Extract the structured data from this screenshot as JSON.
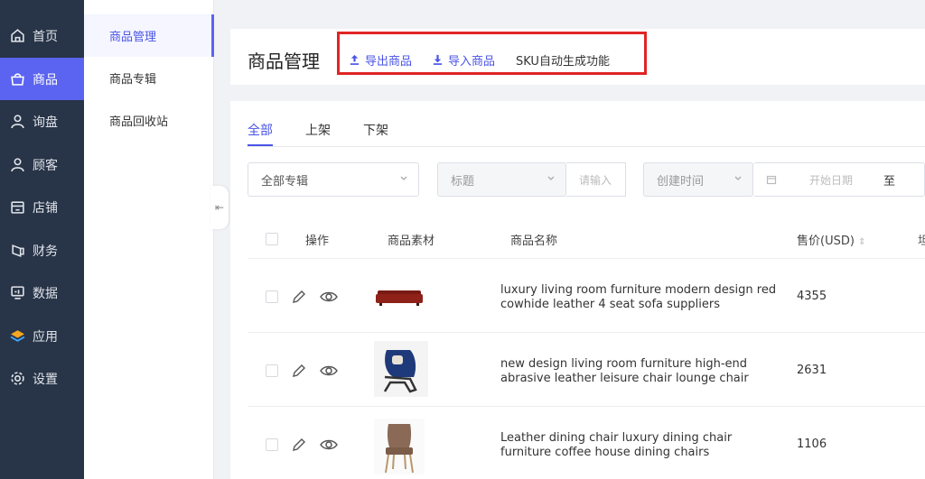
{
  "sidebar": {
    "items": [
      {
        "label": "首页",
        "icon": "home-icon"
      },
      {
        "label": "商品",
        "icon": "bag-icon"
      },
      {
        "label": "询盘",
        "icon": "person-icon"
      },
      {
        "label": "顾客",
        "icon": "person-icon"
      },
      {
        "label": "店铺",
        "icon": "store-icon"
      },
      {
        "label": "财务",
        "icon": "wallet-icon"
      },
      {
        "label": "数据",
        "icon": "monitor-icon"
      },
      {
        "label": "应用",
        "icon": "layers-icon"
      },
      {
        "label": "设置",
        "icon": "gear-icon"
      }
    ],
    "active_color": "#5b64f0",
    "bg_color": "#283447"
  },
  "subnav": {
    "items": [
      {
        "label": "商品管理"
      },
      {
        "label": "商品专辑"
      },
      {
        "label": "商品回收站"
      }
    ]
  },
  "header": {
    "title": "商品管理",
    "export_label": "导出商品",
    "import_label": "导入商品",
    "sku_label": "SKU自动生成功能",
    "highlight_color": "#e02424"
  },
  "tabs": [
    {
      "label": "全部"
    },
    {
      "label": "上架"
    },
    {
      "label": "下架"
    }
  ],
  "filters": {
    "album": "全部专辑",
    "field": "标题",
    "field_input_placeholder": "请输入",
    "time": "创建时间",
    "start_date_placeholder": "开始日期",
    "range_sep": "至"
  },
  "table": {
    "headers": {
      "actions": "操作",
      "media": "商品素材",
      "name": "商品名称",
      "price": "售价(USD)"
    },
    "rows": [
      {
        "name": "luxury living room furniture modern design red cowhide leather 4 seat sofa suppliers",
        "price": "4355",
        "thumb": "red-sofa"
      },
      {
        "name": "new design living room furniture high-end abrasive leather leisure chair lounge chair",
        "price": "2631",
        "thumb": "blue-chair"
      },
      {
        "name": "Leather dining chair luxury dining chair furniture coffee house dining chairs",
        "price": "1106",
        "thumb": "brown-chair"
      }
    ]
  },
  "accent_color": "#4a54e8"
}
